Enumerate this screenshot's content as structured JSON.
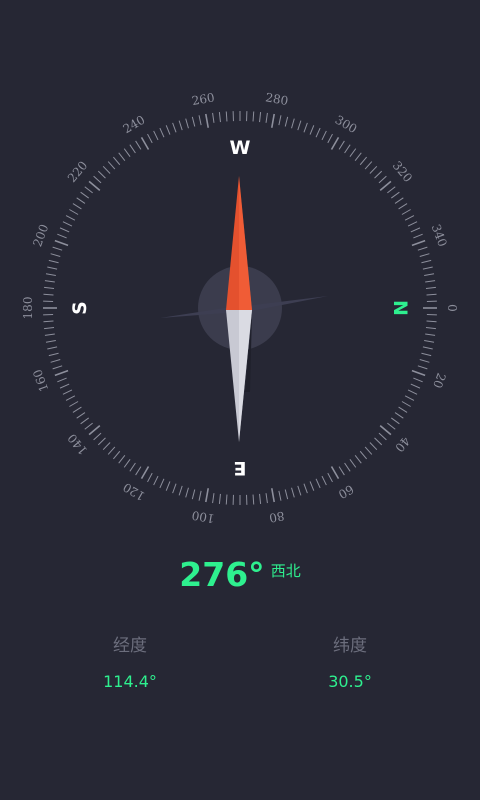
{
  "compass": {
    "degree_labels": [
      "0",
      "20",
      "40",
      "60",
      "80",
      "100",
      "120",
      "140",
      "160",
      "180",
      "200",
      "220",
      "240",
      "260",
      "280",
      "300",
      "320",
      "340"
    ],
    "cardinals": {
      "N": "N",
      "E": "E",
      "S": "S",
      "W": "W"
    },
    "colors": {
      "background": "#262734",
      "ring": "#8d8f9c",
      "north_accent": "#2ef08f",
      "needle_north": "#e4512e",
      "needle_south": "#c8c9d3"
    }
  },
  "heading": {
    "value": "276°",
    "direction": "西北"
  },
  "coords": {
    "longitude_label": "经度",
    "longitude_value": "114.4°",
    "latitude_label": "纬度",
    "latitude_value": "30.5°"
  }
}
